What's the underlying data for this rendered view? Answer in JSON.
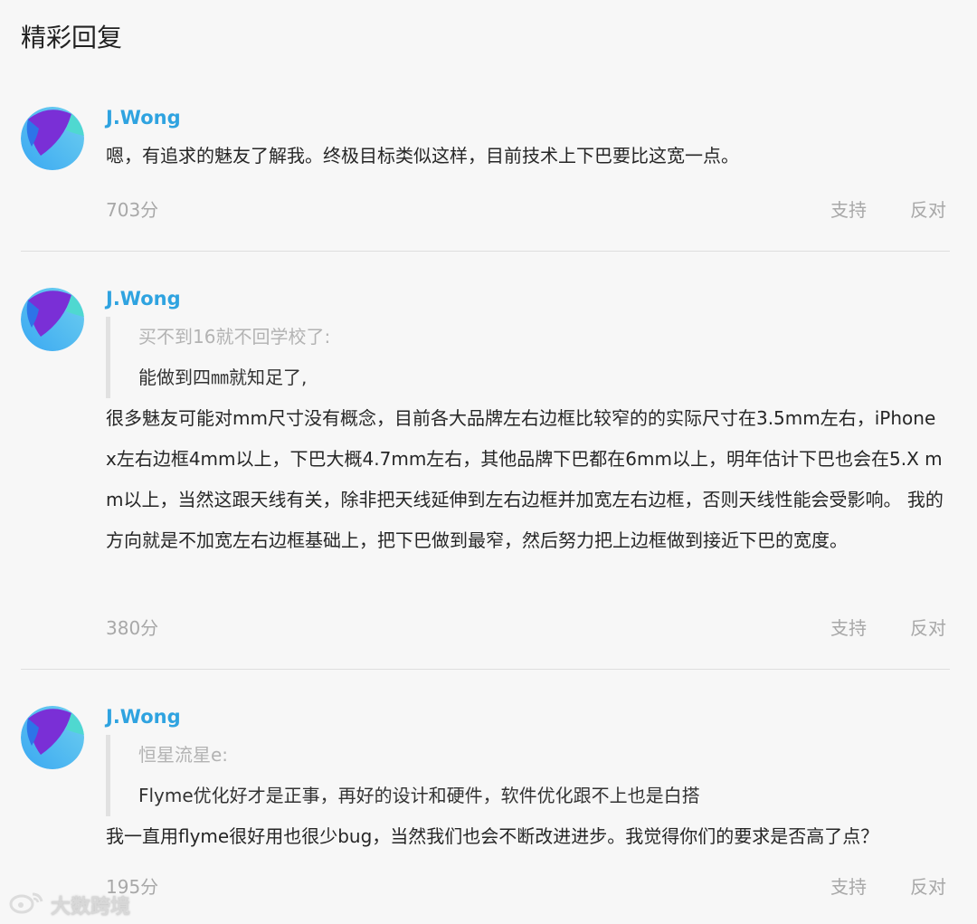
{
  "section_title": "精彩回复",
  "colors": {
    "username": "#2fa3e0",
    "meta": "#a8a8a8",
    "quote_bar": "#e1e1e1"
  },
  "replies": [
    {
      "user": "J.Wong",
      "text": "嗯，有追求的魅友了解我。终极目标类似这样，目前技术上下巴要比这宽一点。",
      "score": "703分",
      "support_label": "支持",
      "oppose_label": "反对"
    },
    {
      "user": "J.Wong",
      "quote_author": "买不到16就不回学校了:",
      "quote_text": "能做到四㎜就知足了,",
      "text": "很多魅友可能对mm尺寸没有概念，目前各大品牌左右边框比较窄的的实际尺寸在3.5mm左右，iPhone x左右边框4mm以上，下巴大概4.7mm左右，其他品牌下巴都在6mm以上，明年估计下巴也会在5.X mm以上，当然这跟天线有关，除非把天线延伸到左右边框并加宽左右边框，否则天线性能会受影响。 我的方向就是不加宽左右边框基础上，把下巴做到最窄，然后努力把上边框做到接近下巴的宽度。",
      "score": "380分",
      "support_label": "支持",
      "oppose_label": "反对"
    },
    {
      "user": "J.Wong",
      "quote_author": "恒星流星e:",
      "quote_text": "Flyme优化好才是正事，再好的设计和硬件，软件优化跟不上也是白搭",
      "text": "我一直用flyme很好用也很少bug，当然我们也会不断改进进步。我觉得你们的要求是否高了点？",
      "score": "195分",
      "support_label": "支持",
      "oppose_label": "反对"
    }
  ],
  "watermark": {
    "text": "大数跨境",
    "icon": "weibo-logo-icon"
  }
}
